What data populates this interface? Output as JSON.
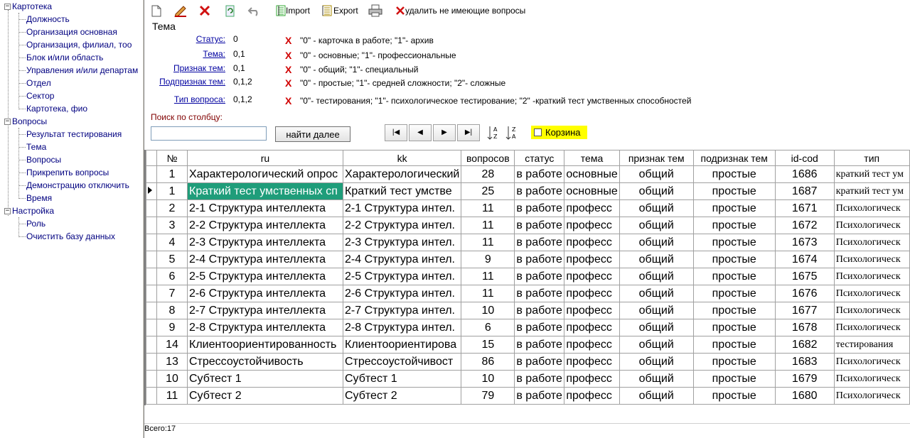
{
  "tree": {
    "nodes": [
      {
        "label": "Картотека",
        "level": 0
      },
      {
        "label": "Должность",
        "level": 1
      },
      {
        "label": "Организация основная",
        "level": 1
      },
      {
        "label": "Организация, филиал, тоо",
        "level": 1
      },
      {
        "label": "Блок и/или область",
        "level": 1
      },
      {
        "label": "Управления и/или департам",
        "level": 1
      },
      {
        "label": "Отдел",
        "level": 1
      },
      {
        "label": "Сектор",
        "level": 1
      },
      {
        "label": "Картотека, фио",
        "level": 1
      },
      {
        "label": "Вопросы",
        "level": 0
      },
      {
        "label": "Результат тестирования",
        "level": 1
      },
      {
        "label": "Тема",
        "level": 1
      },
      {
        "label": "Вопросы",
        "level": 1
      },
      {
        "label": "Прикрепить вопросы",
        "level": 1
      },
      {
        "label": "Демонстрацию отключить",
        "level": 1
      },
      {
        "label": "Время",
        "level": 1
      },
      {
        "label": "Настройка",
        "level": 0
      },
      {
        "label": "Роль",
        "level": 1
      },
      {
        "label": "Очистить базу данных",
        "level": 1
      }
    ]
  },
  "toolbar": {
    "import_label": "Import",
    "export_label": "Export",
    "delete_unused_label": "удалить не имеющие вопросы"
  },
  "title": "Тема",
  "filters": [
    {
      "label": "Статус:",
      "value": "0",
      "hint": "\"0\" - карточка в работе; \"1\"- архив"
    },
    {
      "label": "Тема:",
      "value": "0,1",
      "hint": "\"0\" - основные; \"1\"- профессиональные"
    },
    {
      "label": "Признак тем:",
      "value": "0,1",
      "hint": "\"0\" - общий; \"1\"- специальный"
    },
    {
      "label": "Подпризнак тем:",
      "value": "0,1,2",
      "hint": "\"0\" - простые; \"1\"- средней сложности; \"2\"- сложные"
    },
    {
      "label": "Тип вопроса:",
      "value": "0,1,2",
      "hint": "\"0\"- тестирования; \"1\"- психологическое тестирование; \"2\" -краткий тест умственных способностей"
    }
  ],
  "search": {
    "label": "Поиск по столбцу:",
    "value": "",
    "find_next_label": "найти далее"
  },
  "basket_label": "Корзина",
  "grid": {
    "columns": [
      "№",
      "ru",
      "kk",
      "вопросов",
      "статус",
      "тема",
      "признак тем",
      "подризнак тем",
      "id-cod",
      "тип"
    ],
    "rows": [
      [
        "1",
        "Характерологический опрос",
        "Характерологический",
        "28",
        "в работе",
        "основные",
        "общий",
        "простые",
        "1686",
        "краткий тест ум"
      ],
      [
        "1",
        "Краткий тест умственных сп",
        "Краткий тест умстве",
        "25",
        "в работе",
        "основные",
        "общий",
        "простые",
        "1687",
        "краткий тест ум"
      ],
      [
        "2",
        "2-1 Структура интеллекта",
        "2-1 Структура интел.",
        "11",
        "в работе",
        "професс",
        "общий",
        "простые",
        "1671",
        "Психологическ"
      ],
      [
        "3",
        "2-2 Структура интеллекта",
        "2-2 Структура интел.",
        "11",
        "в работе",
        "професс",
        "общий",
        "простые",
        "1672",
        "Психологическ"
      ],
      [
        "4",
        "2-3 Структура интеллекта",
        "2-3 Структура интел.",
        "11",
        "в работе",
        "професс",
        "общий",
        "простые",
        "1673",
        "Психологическ"
      ],
      [
        "5",
        "2-4 Структура интеллекта",
        "2-4 Структура интел.",
        "9",
        "в работе",
        "професс",
        "общий",
        "простые",
        "1674",
        "Психологическ"
      ],
      [
        "6",
        "2-5 Структура интеллекта",
        "2-5 Структура интел.",
        "11",
        "в работе",
        "професс",
        "общий",
        "простые",
        "1675",
        "Психологическ"
      ],
      [
        "7",
        "2-6 Структура интеллекта",
        "2-6 Структура интел.",
        "11",
        "в работе",
        "професс",
        "общий",
        "простые",
        "1676",
        "Психологическ"
      ],
      [
        "8",
        "2-7 Структура интеллекта",
        "2-7 Структура интел.",
        "10",
        "в работе",
        "професс",
        "общий",
        "простые",
        "1677",
        "Психологическ"
      ],
      [
        "9",
        "2-8 Структура интеллекта",
        "2-8 Структура интел.",
        "6",
        "в работе",
        "професс",
        "общий",
        "простые",
        "1678",
        "Психологическ"
      ],
      [
        "14",
        "Клиентоориентированность",
        "Клиентоориентирова",
        "15",
        "в работе",
        "професс",
        "общий",
        "простые",
        "1682",
        "тестирования"
      ],
      [
        "13",
        "Стрессоустойчивость",
        "Стрессоустойчивост",
        "86",
        "в работе",
        "професс",
        "общий",
        "простые",
        "1683",
        "Психологическ"
      ],
      [
        "10",
        "Субтест 1",
        "Субтест 1",
        "10",
        "в работе",
        "професс",
        "общий",
        "простые",
        "1679",
        "Психологическ"
      ],
      [
        "11",
        "Субтест 2",
        "Субтест 2",
        "79",
        "в работе",
        "професс",
        "общий",
        "простые",
        "1680",
        "Психологическ"
      ]
    ],
    "selected_row": 1
  },
  "status_text": "Всего:17"
}
